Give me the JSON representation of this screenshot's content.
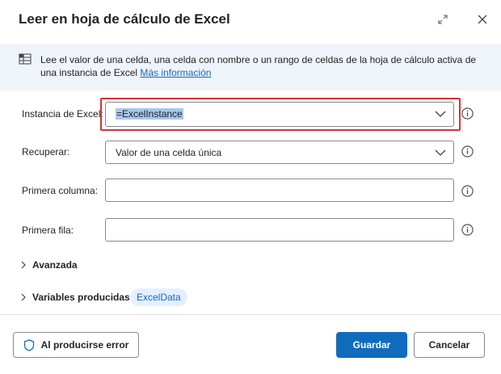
{
  "dialog": {
    "title": "Leer en hoja de cálculo de Excel"
  },
  "info": {
    "text": "Lee el valor de una celda, una celda con nombre o un rango de celdas de la hoja de cálculo activa de una instancia de Excel",
    "link": "Más información"
  },
  "fields": {
    "instance": {
      "label": "Instancia de Excel:",
      "value": "=ExcelInstance"
    },
    "retrieve": {
      "label": "Recuperar:",
      "value": "Valor de una celda única"
    },
    "first_column": {
      "label": "Primera columna:",
      "value": ""
    },
    "first_row": {
      "label": "Primera fila:",
      "value": ""
    }
  },
  "sections": {
    "advanced": "Avanzada",
    "variables": "Variables producidas",
    "variable_chip": "ExcelData"
  },
  "footer": {
    "on_error": "Al producirse error",
    "save": "Guardar",
    "cancel": "Cancelar"
  },
  "colors": {
    "primary": "#0f6cbd",
    "highlight": "#d13438",
    "info_bg": "#eff4fb",
    "selection": "#a8c6ee"
  }
}
